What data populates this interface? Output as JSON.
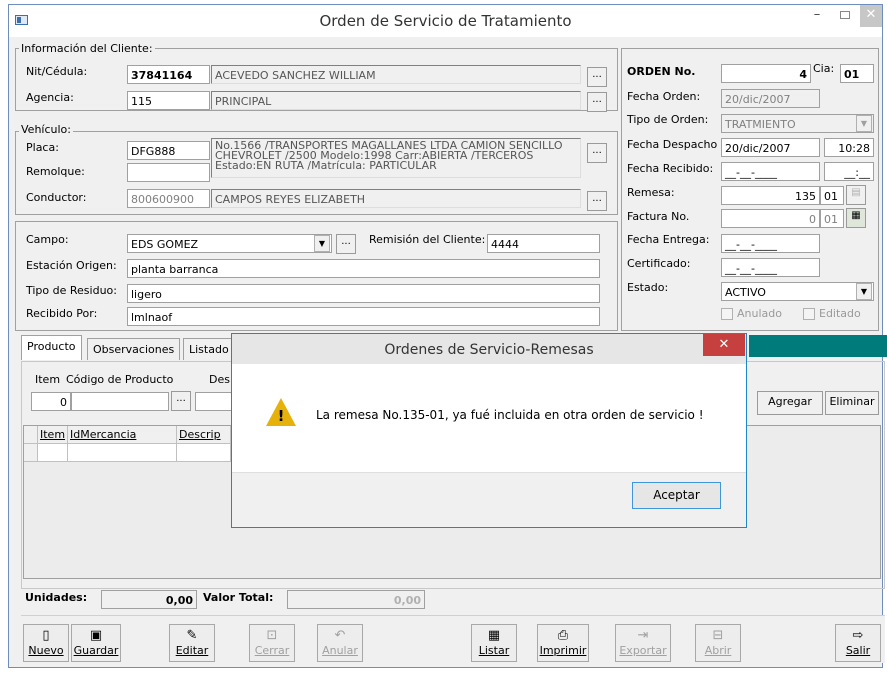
{
  "window": {
    "title": "Orden de Servicio de Tratamiento",
    "min": "–",
    "close": "✕"
  },
  "cliente": {
    "group_label": "Información del Cliente:",
    "nit_label": "Nit/Cédula:",
    "nit_value": "37841164",
    "nit_name": "ACEVEDO SANCHEZ WILLIAM",
    "agencia_label": "Agencia:",
    "agencia_value": "115",
    "agencia_name": "PRINCIPAL"
  },
  "vehiculo": {
    "group_label": "Vehículo:",
    "placa_label": "Placa:",
    "placa_value": "DFG888",
    "placa_desc": "No.1566 /TRANSPORTES MAGALLANES LTDA CAMION SENCILLO CHEVROLET /2500 Modelo:1998 Carr:ABIERTA /TERCEROS Estado:EN RUTA /Matrícula: PARTICULAR",
    "remolque_label": "Remolque:",
    "remolque_value": "",
    "conductor_label": "Conductor:",
    "conductor_value": "800600900",
    "conductor_name": "CAMPOS REYES ELIZABETH"
  },
  "origen": {
    "campo_label": "Campo:",
    "campo_value": "EDS GOMEZ",
    "remision_label": "Remisión del Cliente:",
    "remision_value": "4444",
    "estacion_label": "Estación Origen:",
    "estacion_value": "planta barranca",
    "residuo_label": "Tipo de Residuo:",
    "residuo_value": "ligero",
    "recibido_label": "Recibido Por:",
    "recibido_value": "lmlnaof"
  },
  "orden": {
    "orden_label": "ORDEN No.",
    "orden_value": "4",
    "cia_label": "Cia:",
    "cia_value": "01",
    "fecha_orden_label": "Fecha Orden:",
    "fecha_orden_value": "20/dic/2007",
    "tipo_label": "Tipo de Orden:",
    "tipo_value": "TRATMIENTO",
    "despacho_label": "Fecha Despacho",
    "despacho_value": "20/dic/2007",
    "despacho_hora": "10:28",
    "recibido_label": "Fecha Recibido:",
    "recibido_value": "__-__-____",
    "recibido_hora": "__:__",
    "remesa_label": "Remesa:",
    "remesa_value": "135",
    "remesa_cia": "01",
    "factura_label": "Factura No.",
    "factura_value": "0",
    "factura_cia": "01",
    "entrega_label": "Fecha Entrega:",
    "entrega_value": "__-__-____",
    "certificado_label": "Certificado:",
    "certificado_value": "__-__-____",
    "estado_label": "Estado:",
    "estado_value": "ACTIVO",
    "anulado_label": "Anulado",
    "editado_label": "Editado"
  },
  "tabs": [
    "Producto",
    "Observaciones",
    "Listado"
  ],
  "producto": {
    "item_label": "Item",
    "codigo_label": "Código de Producto",
    "desc_label": "Des",
    "item_value": "0",
    "agregar": "Agregar",
    "eliminar": "Eliminar"
  },
  "grid": {
    "headers": [
      "Item",
      "IdMercancia",
      "Descrip"
    ]
  },
  "totals": {
    "unidades_label": "Unidades:",
    "unidades_value": "0,00",
    "valor_label": "Valor Total:",
    "valor_value": "0,00"
  },
  "toolbar": {
    "nuevo": "Nuevo",
    "guardar": "Guardar",
    "editar": "Editar",
    "cerrar": "Cerrar",
    "anular": "Anular",
    "listar": "Listar",
    "imprimir": "Imprimir",
    "exportar": "Exportar",
    "abrir": "Abrir",
    "salir": "Salir"
  },
  "dialog": {
    "title": "Ordenes de Servicio-Remesas",
    "close": "✕",
    "message": "La remesa No.135-01, ya fué incluida en otra orden de servicio !",
    "ok": "Aceptar",
    "icon": "warning-icon",
    "accent": "#1e87c8"
  }
}
